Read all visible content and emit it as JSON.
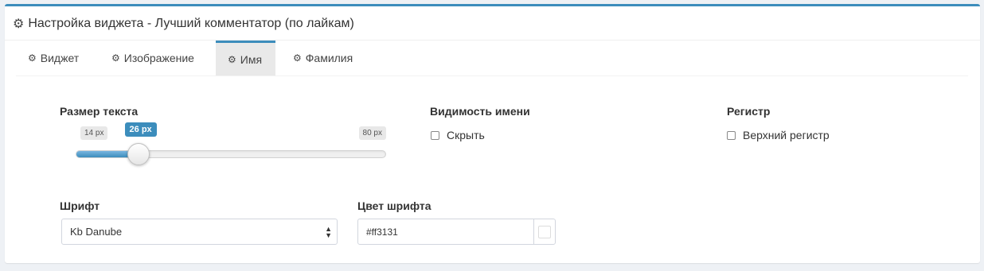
{
  "panel": {
    "title": "Настройка виджета - Лучший комментатор (по лайкам)",
    "accent_color": "#3c8dbc"
  },
  "tabs": [
    {
      "label": "Виджет",
      "icon": "gear-icon",
      "active": false
    },
    {
      "label": "Изображение",
      "icon": "gear-icon",
      "active": false
    },
    {
      "label": "Имя",
      "icon": "gear-icon",
      "active": true
    },
    {
      "label": "Фамилия",
      "icon": "gear-icon",
      "active": false
    }
  ],
  "text_size": {
    "label": "Размер текста",
    "min_label": "14 px",
    "max_label": "80 px",
    "current_label": "26 px",
    "min": 14,
    "max": 80,
    "value": 26
  },
  "name_visibility": {
    "label": "Видимость имени",
    "checkbox_label": "Скрыть",
    "checked": false
  },
  "register": {
    "label": "Регистр",
    "checkbox_label": "Верхний регистр",
    "checked": false
  },
  "font": {
    "label": "Шрифт",
    "selected": "Kb Danube"
  },
  "font_color": {
    "label": "Цвет шрифта",
    "value": "#ff3131"
  }
}
